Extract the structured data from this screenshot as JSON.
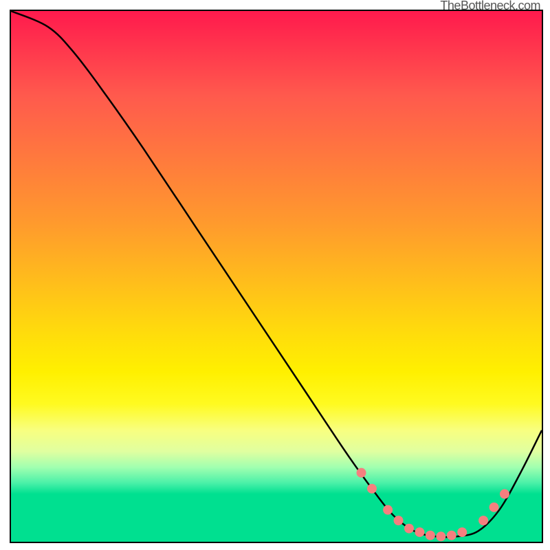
{
  "attribution": "TheBottleneck.com",
  "chart_data": {
    "type": "line",
    "title": "",
    "xlabel": "",
    "ylabel": "",
    "xlim": [
      0,
      100
    ],
    "ylim": [
      0,
      100
    ],
    "curve": [
      {
        "x": 0,
        "y": 100
      },
      {
        "x": 7,
        "y": 97
      },
      {
        "x": 12,
        "y": 92
      },
      {
        "x": 18,
        "y": 84
      },
      {
        "x": 25,
        "y": 74
      },
      {
        "x": 35,
        "y": 59
      },
      {
        "x": 45,
        "y": 44
      },
      {
        "x": 55,
        "y": 29
      },
      {
        "x": 63,
        "y": 17
      },
      {
        "x": 68,
        "y": 10
      },
      {
        "x": 72,
        "y": 5
      },
      {
        "x": 76,
        "y": 2
      },
      {
        "x": 80,
        "y": 1
      },
      {
        "x": 84,
        "y": 1
      },
      {
        "x": 88,
        "y": 2
      },
      {
        "x": 92,
        "y": 6
      },
      {
        "x": 96,
        "y": 13
      },
      {
        "x": 100,
        "y": 21
      }
    ],
    "markers": [
      {
        "x": 66,
        "y": 13
      },
      {
        "x": 68,
        "y": 10
      },
      {
        "x": 71,
        "y": 6
      },
      {
        "x": 73,
        "y": 4
      },
      {
        "x": 75,
        "y": 2.5
      },
      {
        "x": 77,
        "y": 1.8
      },
      {
        "x": 79,
        "y": 1.2
      },
      {
        "x": 81,
        "y": 1
      },
      {
        "x": 83,
        "y": 1.2
      },
      {
        "x": 85,
        "y": 1.8
      },
      {
        "x": 89,
        "y": 4
      },
      {
        "x": 91,
        "y": 6.5
      },
      {
        "x": 93,
        "y": 9
      }
    ],
    "marker_color": "#f57f7f",
    "line_color": "#000000"
  }
}
